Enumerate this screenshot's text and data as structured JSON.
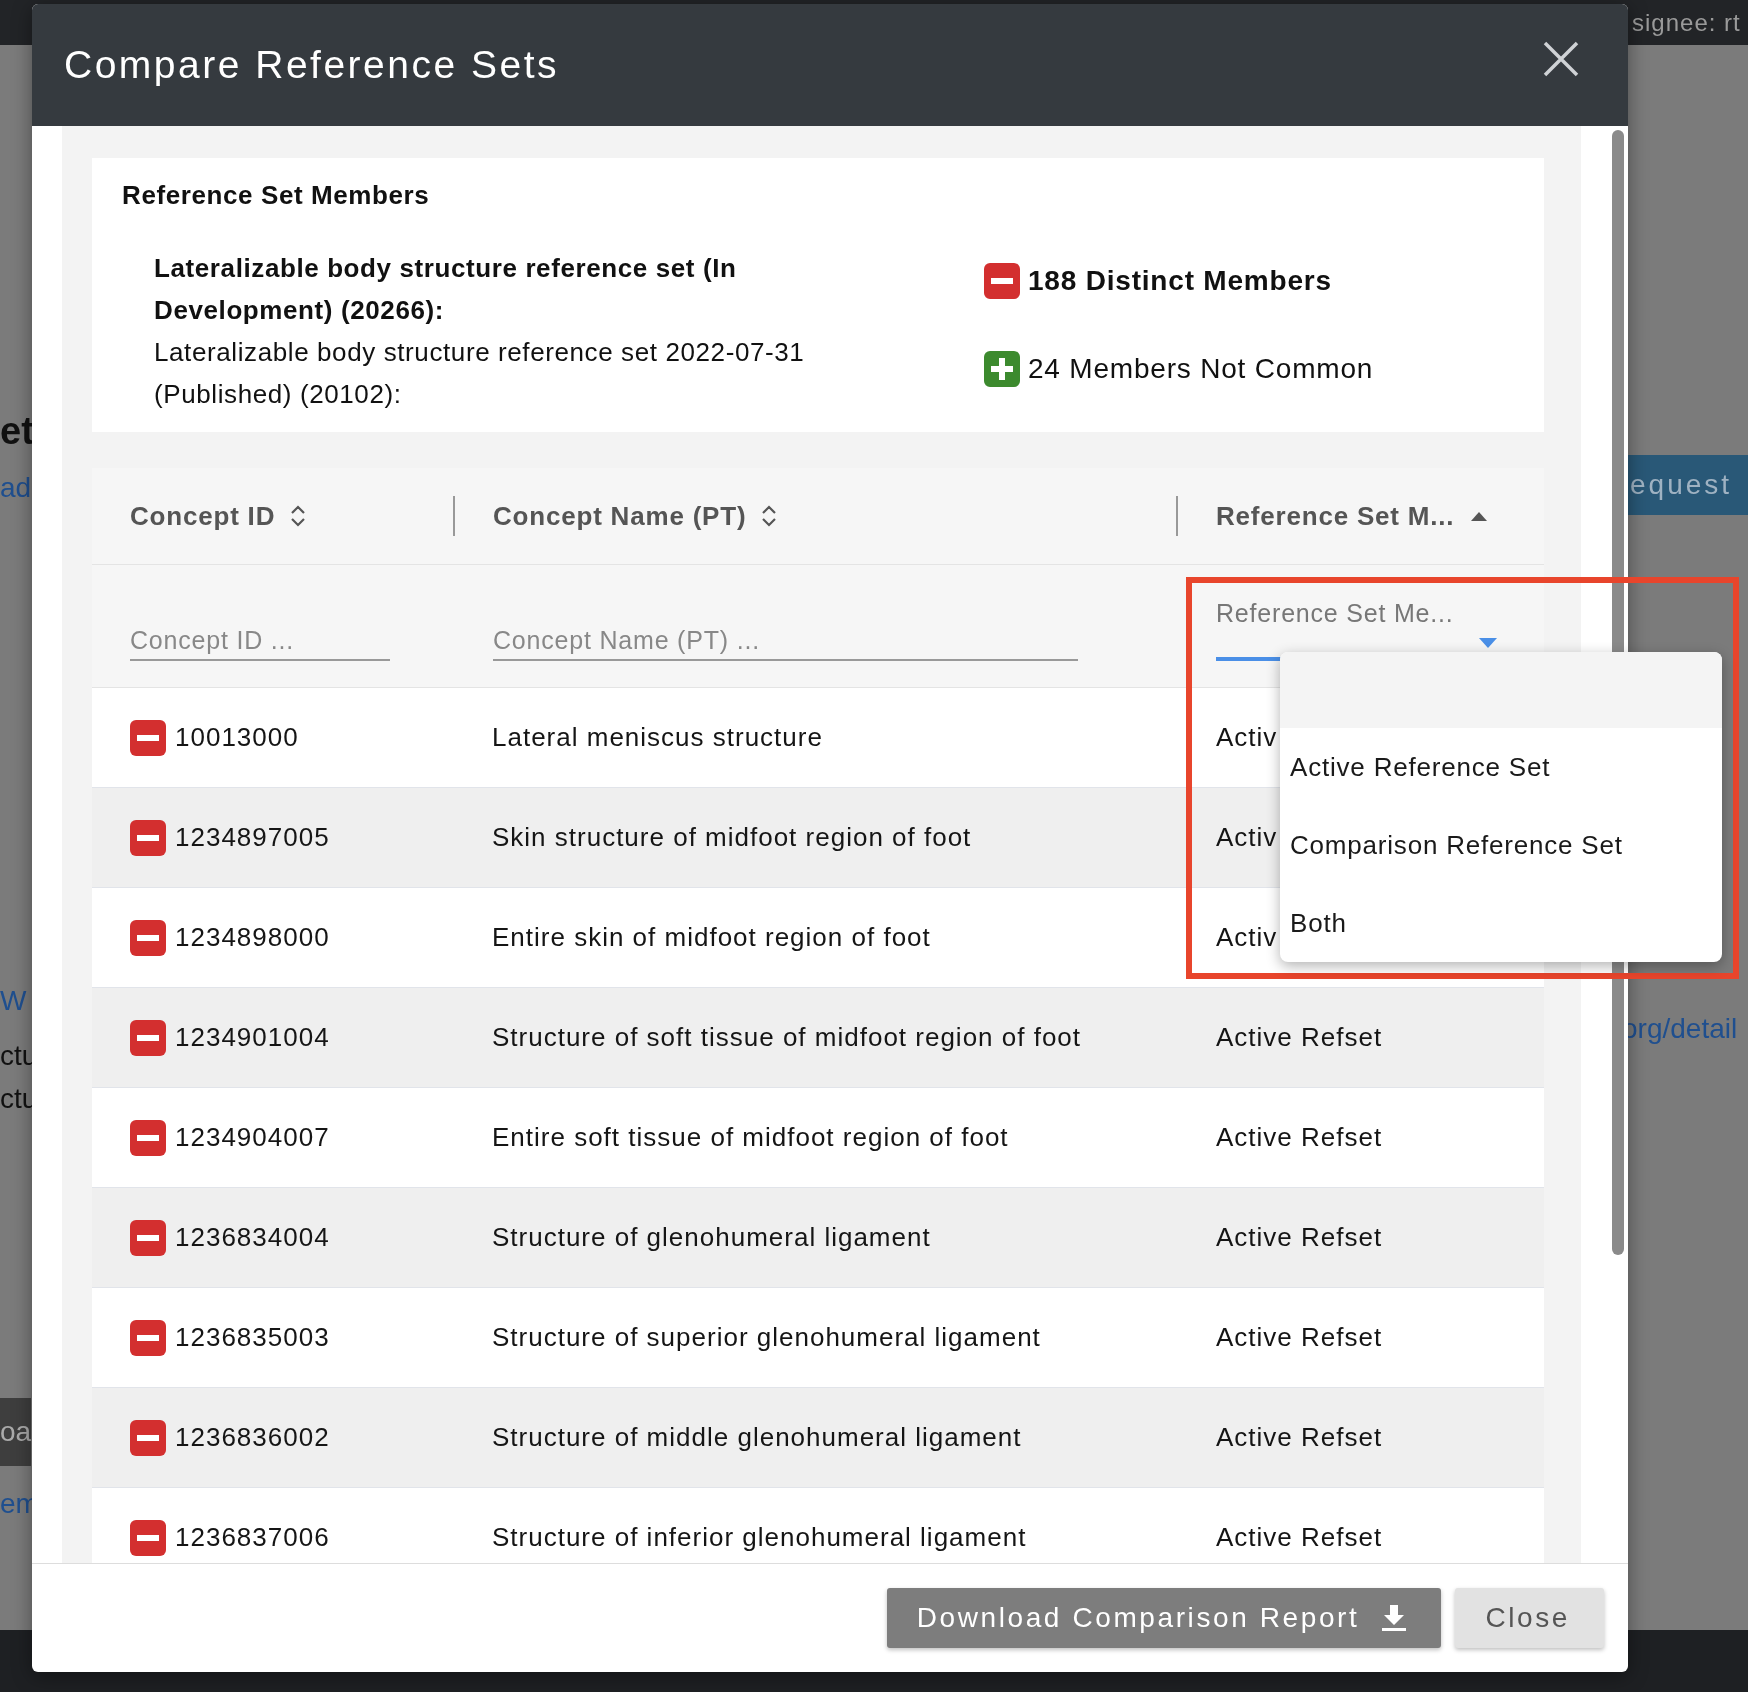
{
  "background": {
    "assignee_fragment": "signee: rt",
    "button_fragment": "equest",
    "link_fragment": "org/detail",
    "left_fragments": [
      {
        "text": "et",
        "kind": "heading"
      },
      {
        "text": "ad",
        "kind": "link"
      },
      {
        "text": "W",
        "kind": "link"
      },
      {
        "text": "ctu",
        "kind": "text"
      },
      {
        "text": "ctu",
        "kind": "text"
      },
      {
        "text": "oa",
        "kind": "button"
      },
      {
        "text": "em",
        "kind": "link"
      }
    ]
  },
  "dialog": {
    "title": "Compare Reference Sets"
  },
  "summary": {
    "title": "Reference Set Members",
    "sets": [
      {
        "label": "Lateralizable body structure reference set (In Development) (20266):",
        "bold": true
      },
      {
        "label": "Lateralizable body structure reference set 2022-07-31 (Published) (20102):",
        "bold": false
      }
    ],
    "stats": [
      {
        "kind": "distinct",
        "text": "188 Distinct Members",
        "bold": true
      },
      {
        "kind": "not_common",
        "text": "24 Members Not Common",
        "bold": false
      }
    ]
  },
  "table": {
    "columns": [
      {
        "label": "Concept ID",
        "sorted": false
      },
      {
        "label": "Concept Name (PT)",
        "sorted": false
      },
      {
        "label": "Reference Set M...",
        "sorted": true
      }
    ],
    "filters": [
      {
        "kind": "text",
        "placeholder": "Concept ID ..."
      },
      {
        "kind": "text",
        "placeholder": "Concept Name (PT) ..."
      },
      {
        "kind": "select",
        "placeholder": "Reference Set Me...",
        "open": true
      }
    ],
    "rows": [
      {
        "kind": "distinct",
        "concept_id": "10013000",
        "name": "Lateral meniscus structure",
        "membership": "Activ"
      },
      {
        "kind": "distinct",
        "concept_id": "1234897005",
        "name": "Skin structure of midfoot region of foot",
        "membership": "Activ"
      },
      {
        "kind": "distinct",
        "concept_id": "1234898000",
        "name": "Entire skin of midfoot region of foot",
        "membership": "Activ"
      },
      {
        "kind": "distinct",
        "concept_id": "1234901004",
        "name": "Structure of soft tissue of midfoot region of foot",
        "membership": "Active Refset"
      },
      {
        "kind": "distinct",
        "concept_id": "1234904007",
        "name": "Entire soft tissue of midfoot region of foot",
        "membership": "Active Refset"
      },
      {
        "kind": "distinct",
        "concept_id": "1236834004",
        "name": "Structure of glenohumeral ligament",
        "membership": "Active Refset"
      },
      {
        "kind": "distinct",
        "concept_id": "1236835003",
        "name": "Structure of superior glenohumeral ligament",
        "membership": "Active Refset"
      },
      {
        "kind": "distinct",
        "concept_id": "1236836002",
        "name": "Structure of middle glenohumeral ligament",
        "membership": "Active Refset"
      },
      {
        "kind": "distinct",
        "concept_id": "1236837006",
        "name": "Structure of inferior glenohumeral ligament",
        "membership": "Active Refset"
      }
    ]
  },
  "dropdown": {
    "empty_option_highlighted": true,
    "options": [
      {
        "label": "Active Reference Set"
      },
      {
        "label": "Comparison Reference Set"
      },
      {
        "label": "Both"
      }
    ]
  },
  "footer": {
    "buttons": [
      {
        "label": "Download Comparison Report",
        "kind": "download"
      },
      {
        "label": "Close",
        "kind": "plain"
      }
    ]
  }
}
